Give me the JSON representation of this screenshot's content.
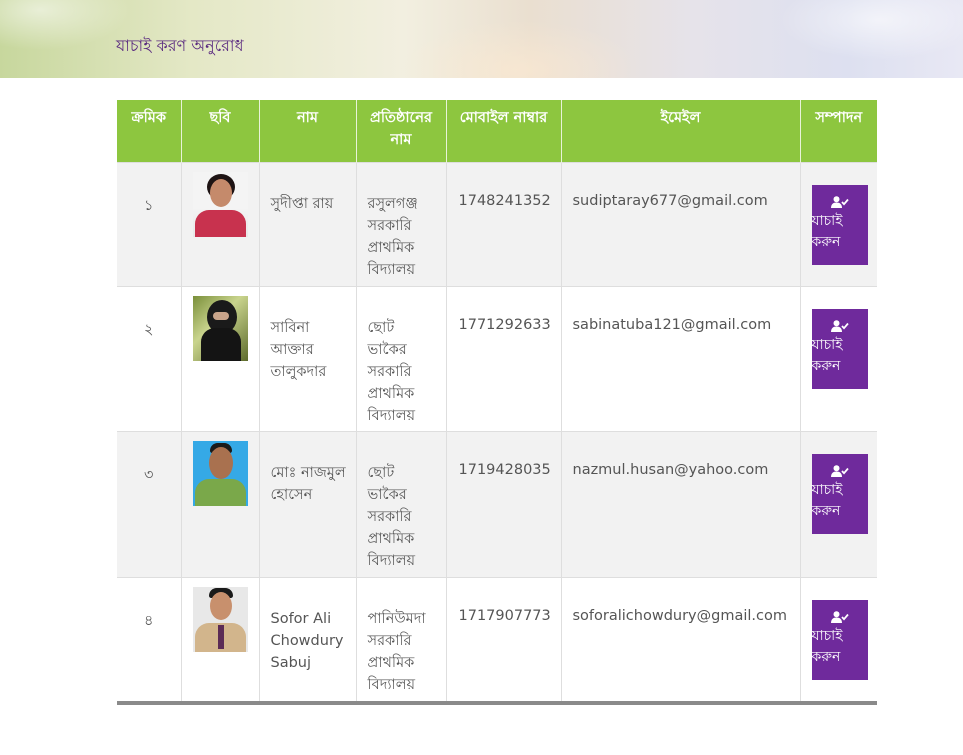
{
  "header": {
    "title": "যাচাই করণ অনুরোধ"
  },
  "table": {
    "columns": [
      "ক্রমিক",
      "ছবি",
      "নাম",
      "প্রতিষ্ঠানের নাম",
      "মোবাইল নাম্বার",
      "ইমেইল",
      "সম্পাদন"
    ],
    "rows": [
      {
        "serial": "১",
        "name": "সুদীপ্তা রায়",
        "institution": "রসুলগঞ্জ সরকারি প্রাথমিক বিদ্যালয়",
        "mobile": "1748241352",
        "email": "sudiptaray677@gmail.com",
        "action": "যাচাই করুন"
      },
      {
        "serial": "২",
        "name": "সাবিনা আক্তার তালুকদার",
        "institution": "ছোট ভাকৈর সরকারি প্রাথমিক বিদ্যালয়",
        "mobile": "1771292633",
        "email": "sabinatuba121@gmail.com",
        "action": "যাচাই করুন"
      },
      {
        "serial": "৩",
        "name": "মোঃ নাজমুল হোসেন",
        "institution": "ছোট ভাকৈর সরকারি প্রাথমিক বিদ্যালয়",
        "mobile": "1719428035",
        "email": "nazmul.husan@yahoo.com",
        "action": "যাচাই করুন"
      },
      {
        "serial": "৪",
        "name": "Sofor Ali Chowdury Sabuj",
        "institution": "পানিউমদা সরকারি প্রাথমিক বিদ্যালয়",
        "mobile": "1717907773",
        "email": "soforalichowdury@gmail.com",
        "action": "যাচাই করুন"
      }
    ]
  },
  "icons": {
    "action": "user-check-icon"
  },
  "colors": {
    "header_bg": "#8dc63f",
    "button_bg": "#6f2a9c",
    "title": "#5a2a80"
  }
}
